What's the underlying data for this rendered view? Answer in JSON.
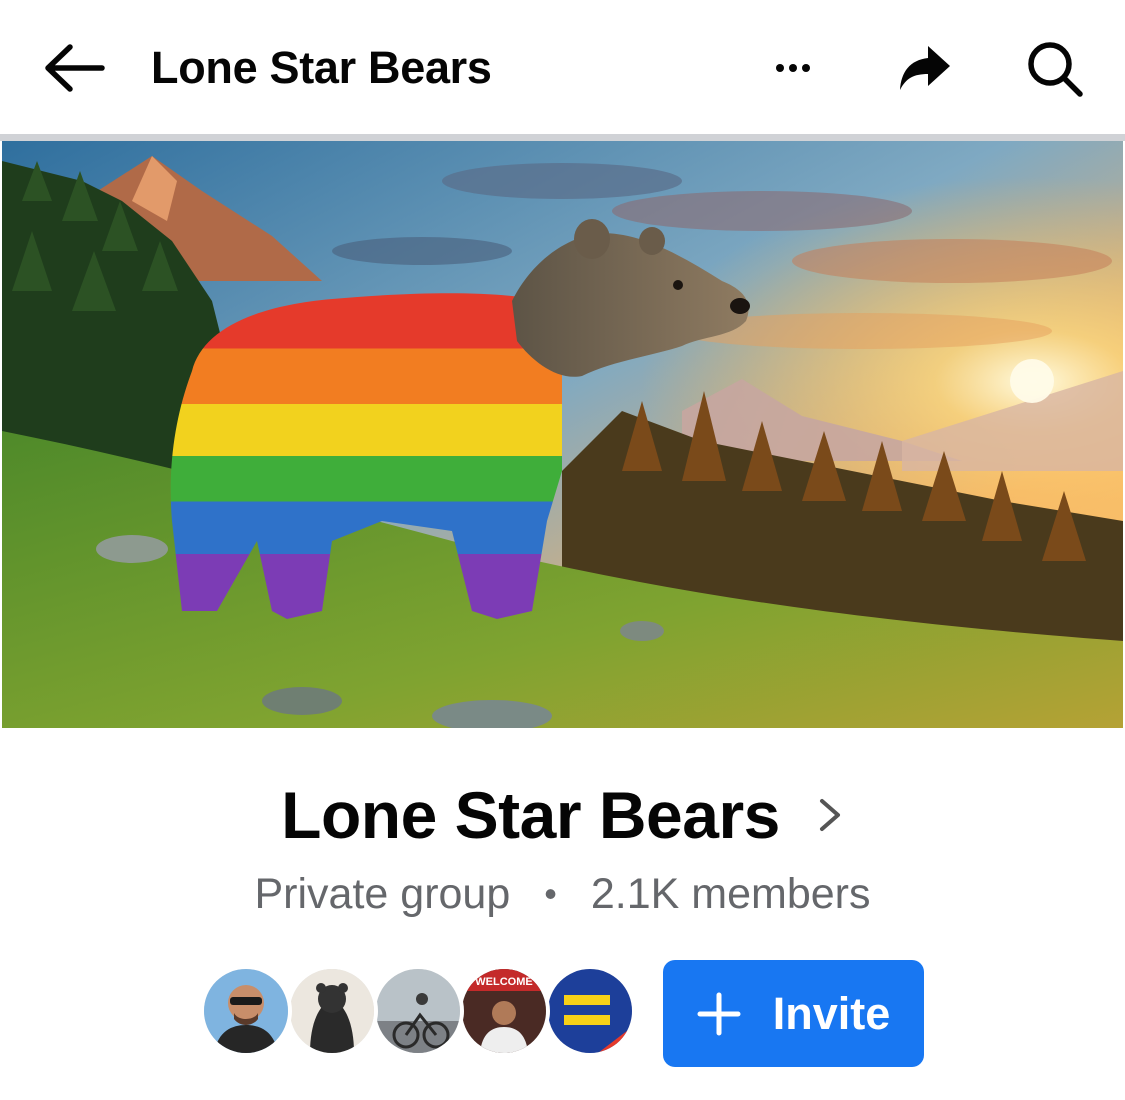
{
  "header": {
    "title": "Lone Star Bears",
    "icons": [
      "back-arrow-icon",
      "more-icon",
      "share-icon",
      "search-icon"
    ]
  },
  "cover": {
    "description_icon": "cover-photo"
  },
  "group": {
    "name": "Lone Star Bears",
    "privacy": "Private group",
    "separator": "•",
    "members": "2.1K members"
  },
  "members_preview": {
    "avatars": [
      "member-avatar-1",
      "member-avatar-2",
      "member-avatar-3",
      "member-avatar-4",
      "member-avatar-5"
    ],
    "avatar5_text": "WELCOME"
  },
  "actions": {
    "invite_label": "Invite"
  },
  "colors": {
    "accent": "#1877f2",
    "text_primary": "#050505",
    "text_secondary": "#65676b"
  }
}
